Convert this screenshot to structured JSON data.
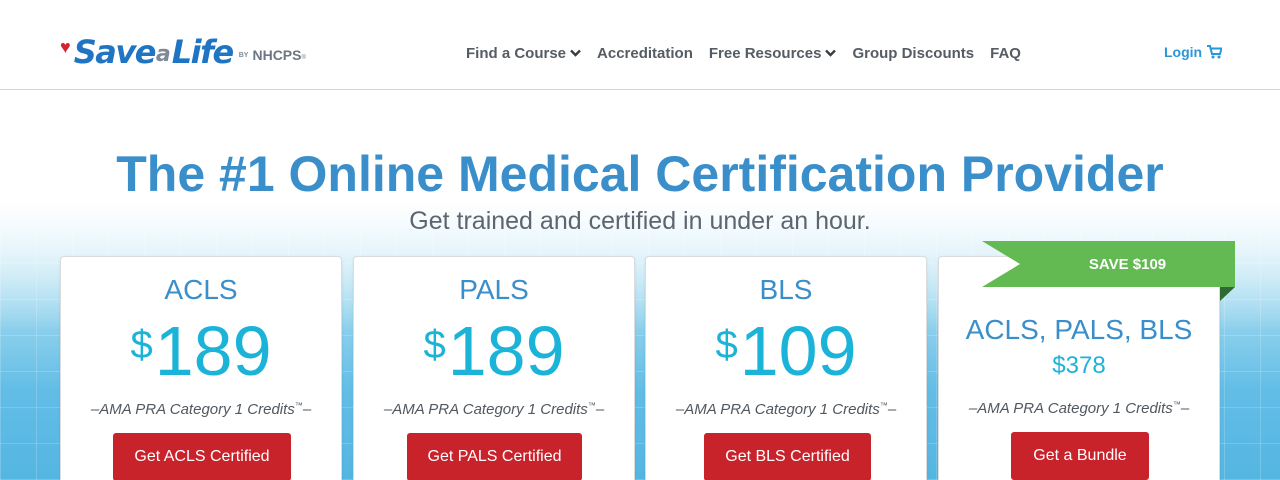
{
  "brand": {
    "save": "Save",
    "a": "a",
    "life": "Life",
    "by": "BY",
    "org": "NHCPS",
    "tm": "®",
    "heart_color": "#d0262e",
    "blue": "#1f75c4"
  },
  "nav": {
    "items": [
      {
        "label": "Find a Course",
        "has_dropdown": true
      },
      {
        "label": "Accreditation",
        "has_dropdown": false
      },
      {
        "label": "Free Resources",
        "has_dropdown": true
      },
      {
        "label": "Group Discounts",
        "has_dropdown": false
      },
      {
        "label": "FAQ",
        "has_dropdown": false
      }
    ],
    "login_label": "Login",
    "cart_icon": "shopping-cart-icon"
  },
  "hero": {
    "title": "The #1 Online Medical Certification Provider",
    "subtitle": "Get trained and certified in under an hour."
  },
  "courses": [
    {
      "name": "ACLS",
      "currency": "$",
      "price": "189",
      "credits": "AMA PRA Category 1 Credits",
      "tm": "™",
      "dash": "–",
      "button": "Get ACLS Certified"
    },
    {
      "name": "PALS",
      "currency": "$",
      "price": "189",
      "credits": "AMA PRA Category 1 Credits",
      "tm": "™",
      "dash": "–",
      "button": "Get PALS Certified"
    },
    {
      "name": "BLS",
      "currency": "$",
      "price": "109",
      "credits": "AMA PRA Category 1 Credits",
      "tm": "™",
      "dash": "–",
      "button": "Get BLS Certified"
    }
  ],
  "bundle": {
    "ribbon": "SAVE $109",
    "name": "ACLS, PALS, BLS",
    "price": "$378",
    "credits": "AMA PRA Category 1 Credits",
    "tm": "™",
    "dash": "–",
    "button": "Get a Bundle"
  },
  "colors": {
    "title_blue": "#3a8fcb",
    "price_cyan": "#1cb3d9",
    "button_red": "#c8222b",
    "ribbon_green": "#63b952",
    "nav_text": "#555c63",
    "login_blue": "#2997d8"
  }
}
